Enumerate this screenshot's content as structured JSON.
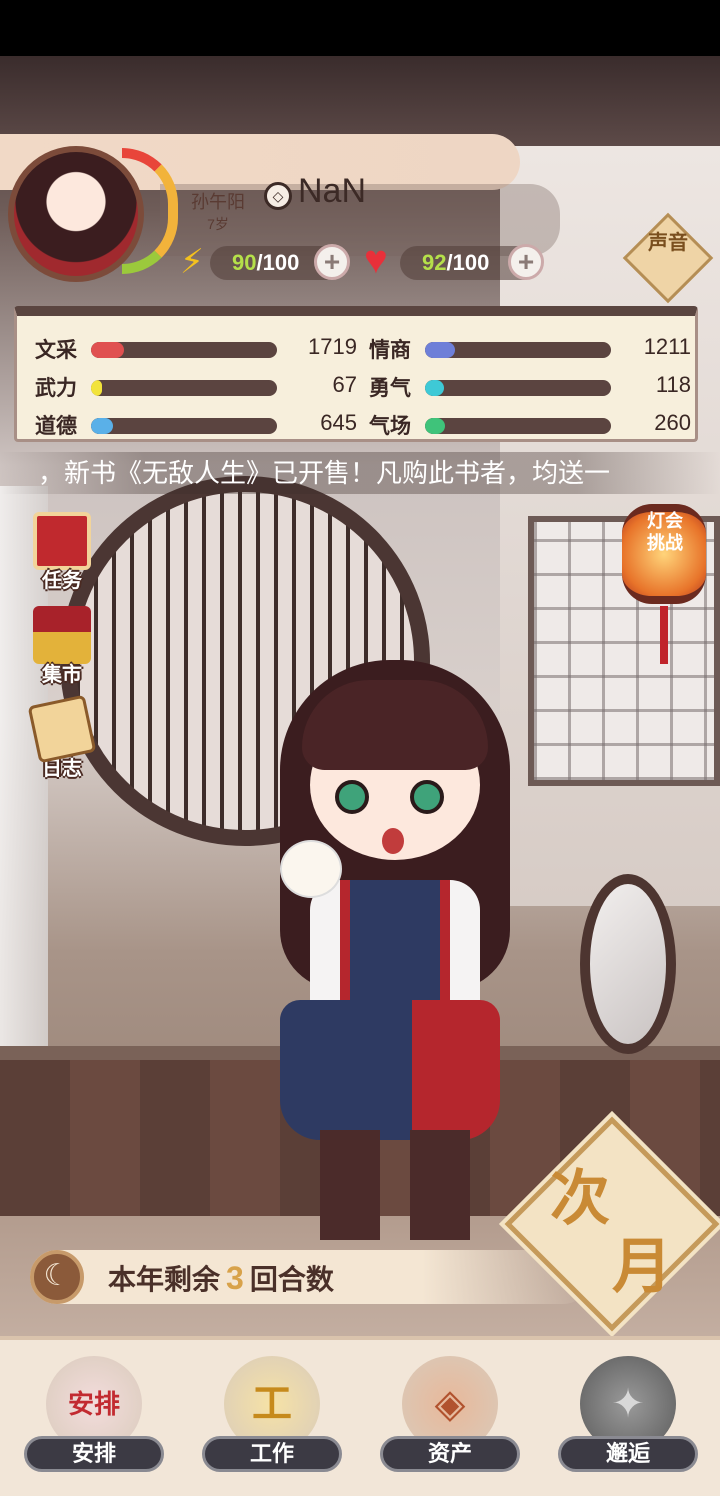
{
  "player": {
    "name": "孙午阳",
    "age": "7岁",
    "id_symbol": "◇",
    "id_value": "NaN"
  },
  "energy": {
    "current": "90",
    "max": "/100"
  },
  "health": {
    "current": "92",
    "max": "/100"
  },
  "sound_label": "声音",
  "stats": {
    "wencai": {
      "label": "文采",
      "value": "1719",
      "color": "#e05050",
      "fill": 0.18
    },
    "wuli": {
      "label": "武力",
      "value": "67",
      "color": "#f2e33a",
      "fill": 0.06
    },
    "daode": {
      "label": "道德",
      "value": "645",
      "color": "#5ab0e8",
      "fill": 0.12
    },
    "qingshang": {
      "label": "情商",
      "value": "1211",
      "color": "#6e7fd8",
      "fill": 0.16
    },
    "yongqi": {
      "label": "勇气",
      "value": "118",
      "color": "#3ec9d6",
      "fill": 0.1
    },
    "qichang": {
      "label": "气场",
      "value": "260",
      "color": "#3fc37a",
      "fill": 0.11
    }
  },
  "marquee_text": "，新书《无敌人生》已开售！凡购此书者，均送一",
  "side_menu": {
    "task": "任务",
    "market": "集市",
    "log": "日志"
  },
  "lantern_text": "灯会挑战",
  "year_bar": {
    "prefix": "本年剩余",
    "count": "3",
    "suffix": "回合数"
  },
  "next_month": {
    "line1": "次",
    "line2": "月"
  },
  "bottom_nav": [
    {
      "label": "安排",
      "icon": "book-icon",
      "glyph": "安排"
    },
    {
      "label": "工作",
      "icon": "hammer-icon",
      "glyph": "工"
    },
    {
      "label": "资产",
      "icon": "coin-icon",
      "glyph": "◈"
    },
    {
      "label": "邂逅",
      "icon": "leaf-icon",
      "glyph": "✦"
    }
  ]
}
